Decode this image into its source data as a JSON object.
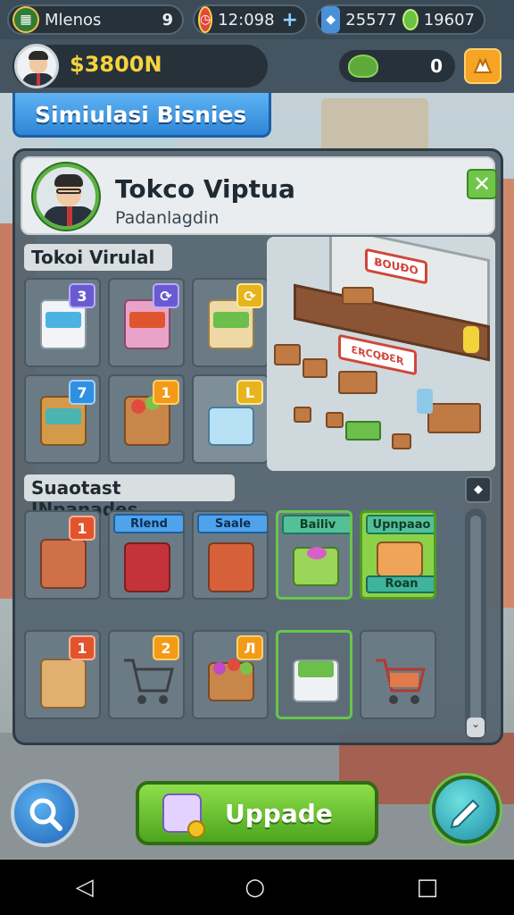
{
  "status_bar": {
    "menu_label": "Mlenos",
    "menu_count": "9",
    "time": "12:098",
    "plus": "+",
    "gems": "25577",
    "coins": "19607"
  },
  "wallet": {
    "cash": "$3800N",
    "leaf_count": "0"
  },
  "sim_title": "Simiulasi Bisnies",
  "profile": {
    "shop_name": "Tokco Viptua",
    "subtitle": "Padanlagdin",
    "close": "✕"
  },
  "section1": {
    "label": "Tokoi Virulal",
    "tiles": [
      {
        "badge": "3"
      },
      {
        "badge": "⟳"
      },
      {
        "badge": "⟳"
      },
      {
        "badge": "7"
      },
      {
        "badge": "1"
      },
      {
        "badge": "L"
      }
    ]
  },
  "shop_illustration": {
    "sign_top": "ɃOUƉO",
    "sign_front": "ƐƦCQƉƐƦ"
  },
  "section2": {
    "label": "Suaotast INpanades",
    "tags": [
      "Rlend",
      "Saale",
      "Bailiv",
      "Upnpaao"
    ],
    "bottom_tag": "Roan",
    "row1_badges": [
      "1"
    ],
    "row2_badges": [
      "1",
      "2",
      "Л"
    ]
  },
  "bottom": {
    "upgrade_label": "Uppade"
  },
  "icons": {
    "search": "search-icon",
    "edit": "pencil-icon"
  },
  "colors": {
    "accent_green": "#6cc241",
    "cash_yellow": "#f5d33c",
    "title_blue": "#2e86d6"
  }
}
